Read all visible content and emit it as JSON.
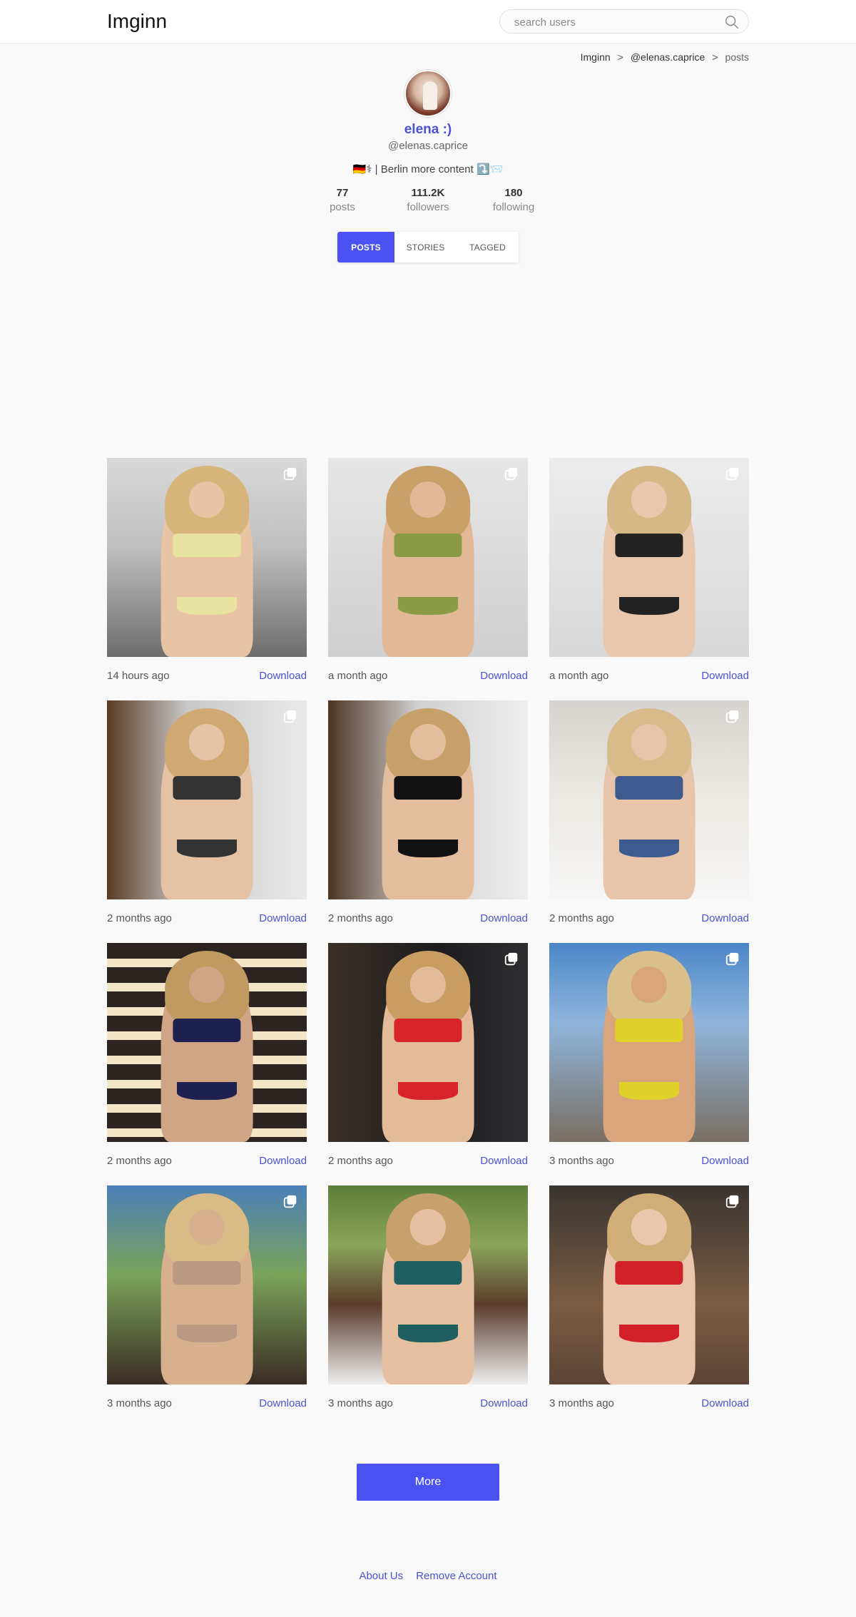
{
  "header": {
    "logo": "Imginn",
    "search_placeholder": "search users"
  },
  "breadcrumb": {
    "home": "Imginn",
    "sep1": ">",
    "profile": "@elenas.caprice",
    "sep2": ">",
    "current": "posts"
  },
  "profile": {
    "fullname": "elena :)",
    "username": "@elenas.caprice",
    "bio": "🇩🇪⚕ | Berlin more content ⤵️📨",
    "stats": [
      {
        "num": "77",
        "label": "posts"
      },
      {
        "num": "111.2K",
        "label": "followers"
      },
      {
        "num": "180",
        "label": "following"
      }
    ]
  },
  "tabs": [
    {
      "label": "POSTS",
      "active": true
    },
    {
      "label": "STORIES",
      "active": false
    },
    {
      "label": "TAGGED",
      "active": false
    }
  ],
  "posts": [
    {
      "time": "14 hours ago",
      "download": "Download",
      "icon": "multi-image-icon"
    },
    {
      "time": "a month ago",
      "download": "Download",
      "icon": "multi-image-icon"
    },
    {
      "time": "a month ago",
      "download": "Download",
      "icon": "multi-image-icon"
    },
    {
      "time": "2 months ago",
      "download": "Download",
      "icon": "multi-image-icon"
    },
    {
      "time": "2 months ago",
      "download": "Download",
      "icon": "none"
    },
    {
      "time": "2 months ago",
      "download": "Download",
      "icon": "multi-image-icon"
    },
    {
      "time": "2 months ago",
      "download": "Download",
      "icon": "none"
    },
    {
      "time": "2 months ago",
      "download": "Download",
      "icon": "multi-image-icon"
    },
    {
      "time": "3 months ago",
      "download": "Download",
      "icon": "multi-image-icon"
    },
    {
      "time": "3 months ago",
      "download": "Download",
      "icon": "multi-image-icon"
    },
    {
      "time": "3 months ago",
      "download": "Download",
      "icon": "none"
    },
    {
      "time": "3 months ago",
      "download": "Download",
      "icon": "multi-image-icon"
    }
  ],
  "more_button": "More",
  "footer": {
    "about": "About Us",
    "remove": "Remove Account"
  },
  "colors": {
    "accent": "#4c52f2",
    "link": "#4a52d6"
  }
}
